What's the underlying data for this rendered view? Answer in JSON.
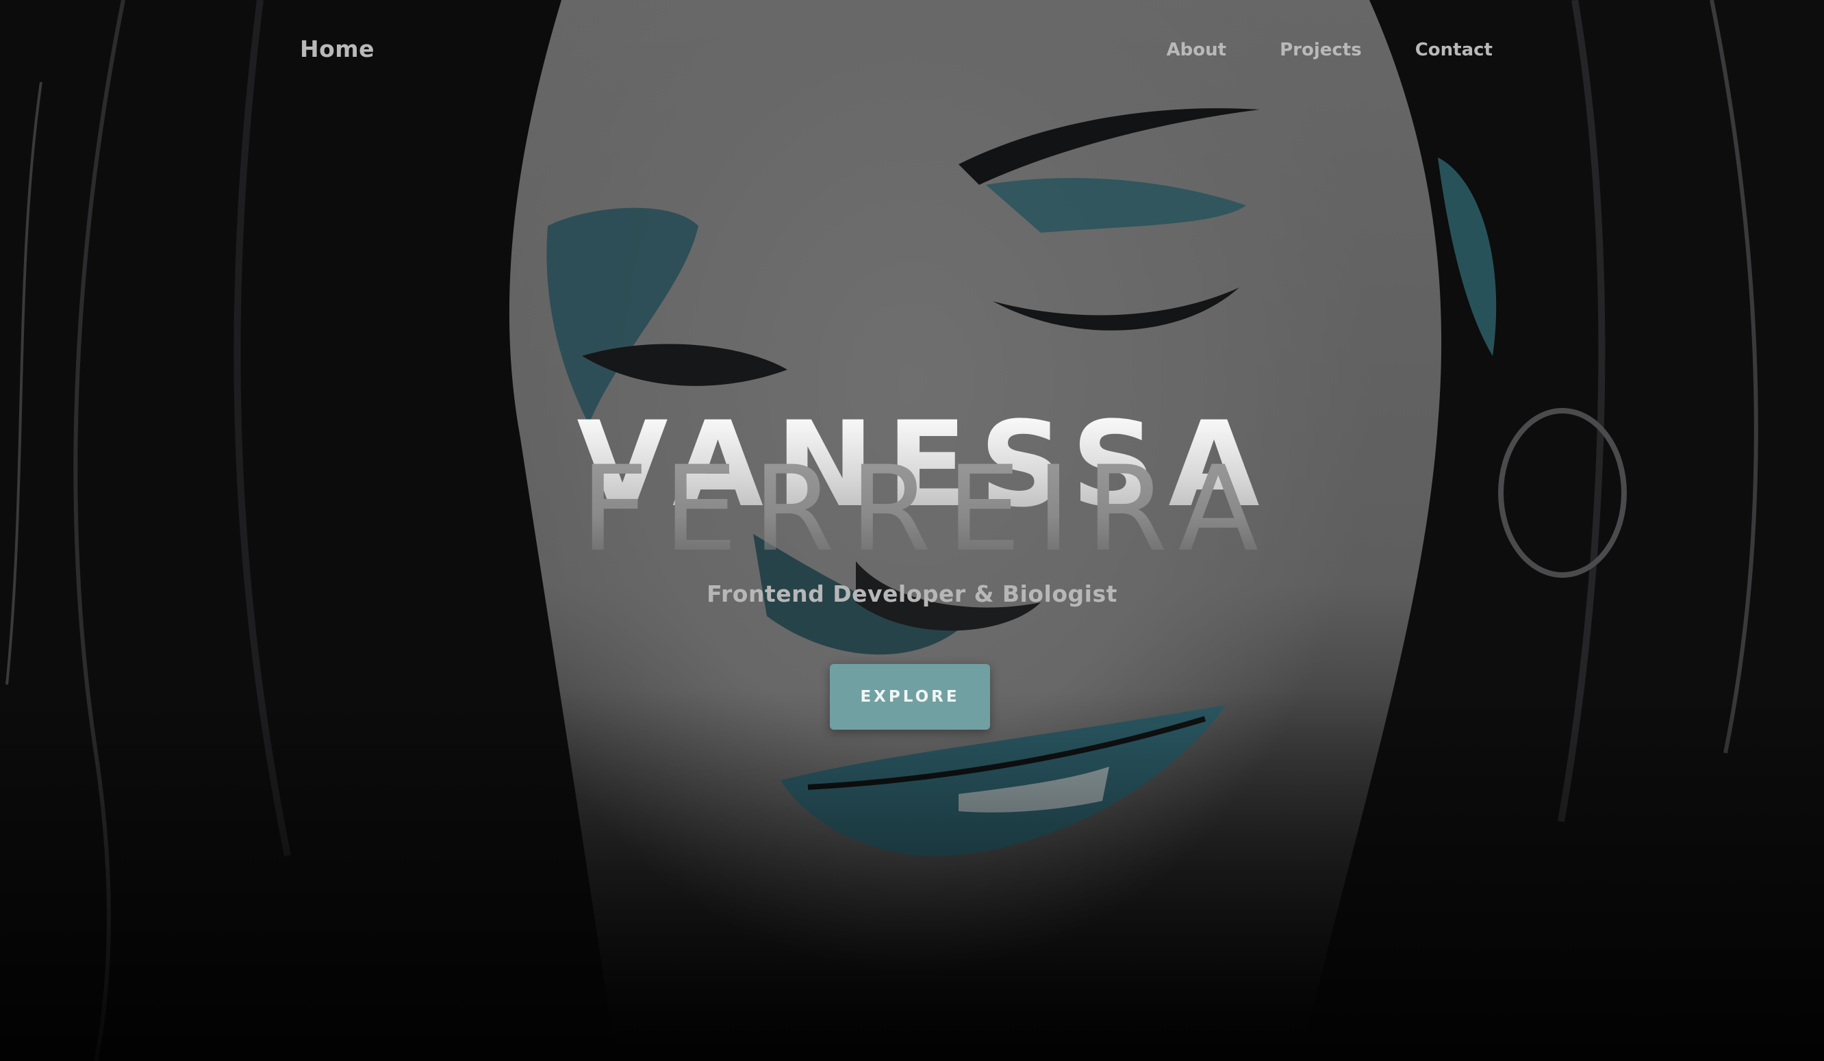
{
  "nav": {
    "home": "Home",
    "links": [
      "About",
      "Projects",
      "Contact"
    ]
  },
  "hero": {
    "first_name": "VANESSA",
    "last_name": "FERREIRA",
    "subtitle": "Frontend Developer & Biologist",
    "cta": "EXPLORE",
    "background_image": "illustrated-portrait"
  },
  "colors": {
    "accent": "#71a0a2",
    "nav_text": "#b9b9b9",
    "background": "#0b0b0c"
  }
}
